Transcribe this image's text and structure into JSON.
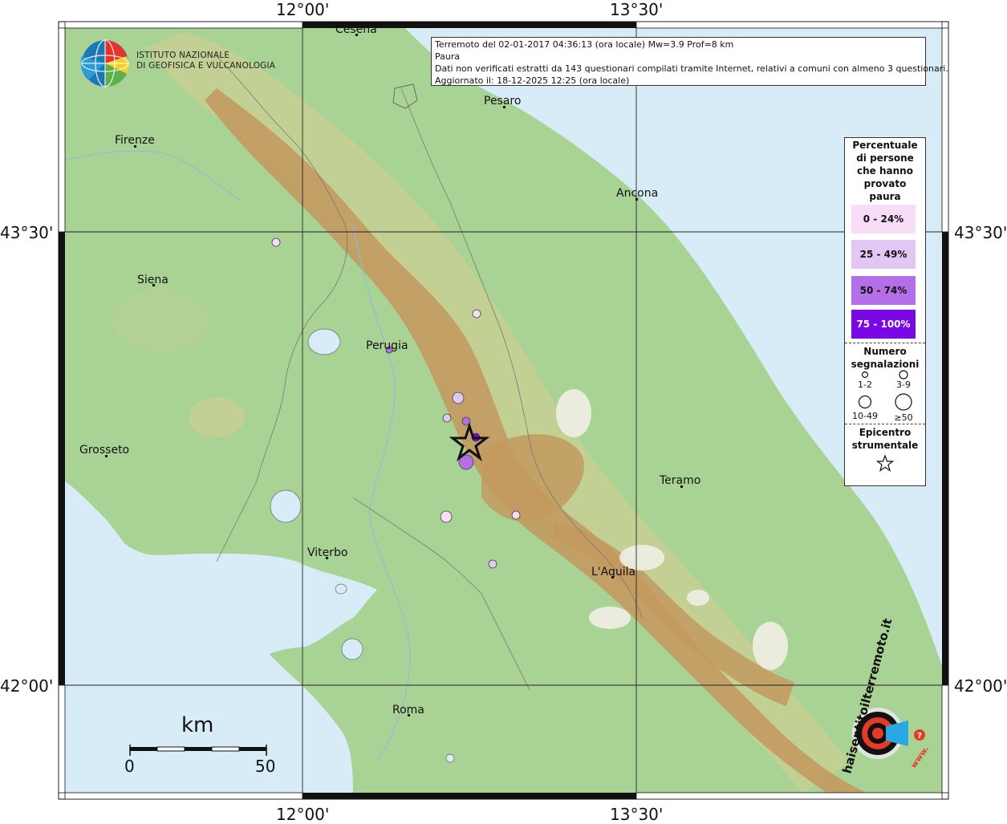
{
  "header": {
    "line1": "Terremoto del 02-01-2017 04:36:13 (ora locale) Mw=3.9 Prof=8 km",
    "line2": "Paura",
    "line3": "Dati non verificati estratti da 143 questionari compilati tramite Internet, relativi a comuni con almeno 3 questionari.",
    "line4": "Aggiornato il: 18-12-2025 12:25 (ora locale)"
  },
  "logo": {
    "line1": "ISTITUTO NAZIONALE",
    "line2": "DI GEOFISICA E VULCANOLOGIA",
    "icon": "ingv-globe-logo"
  },
  "axes": {
    "top_left": "12°00'",
    "top_right": "13°30'",
    "bottom_left": "12°00'",
    "bottom_right": "13°30'",
    "left_top": "43°30'",
    "left_bottom": "42°00'",
    "right_top": "43°30'",
    "right_bottom": "42°00'"
  },
  "cities": {
    "cesena": "Cesena",
    "pesaro": "Pesaro",
    "firenze": "Firenze",
    "ancona": "Ancona",
    "siena": "Siena",
    "perugia": "Perugia",
    "grosseto": "Grosseto",
    "teramo": "Teramo",
    "viterbo": "Viterbo",
    "laquila": "L'Aquila",
    "roma": "Roma"
  },
  "scale": {
    "unit": "km",
    "start": "0",
    "end": "50"
  },
  "legend": {
    "title_lines": [
      "Percentuale",
      "di persone",
      "che hanno",
      "provato",
      "paura"
    ],
    "classes": [
      {
        "label": "0 - 24%",
        "color": "#f8dcf8",
        "text_color": "#111111"
      },
      {
        "label": "25 - 49%",
        "color": "#e2c6f4",
        "text_color": "#111111"
      },
      {
        "label": "50 - 74%",
        "color": "#b46ee8",
        "text_color": "#111111"
      },
      {
        "label": "75 - 100%",
        "color": "#7a08e6",
        "text_color": "#ffffff"
      }
    ],
    "num_title_lines": [
      "Numero",
      "segnalazioni"
    ],
    "sizes": [
      "1-2",
      "3-9",
      "10-49",
      "≥50"
    ],
    "epi_title_lines": [
      "Epicentro",
      "strumentale"
    ]
  },
  "watermark": {
    "text": "haisentitoilterremoto.it",
    "url": "www."
  },
  "colors": {
    "sea": "#d8ecf8",
    "lowland": "#9fcf8e",
    "hills": "#c9cf96",
    "mountains": "#c49a5e",
    "peaks": "#efece4",
    "frame": "#111111"
  }
}
